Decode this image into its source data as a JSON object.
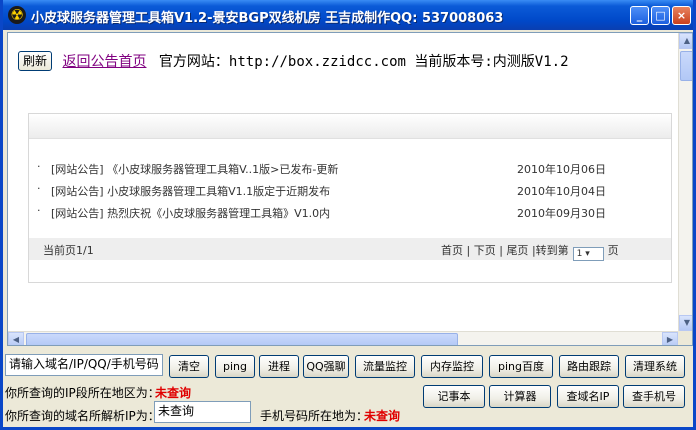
{
  "window": {
    "title": "小皮球服务器管理工具箱V1.2-景安BGP双线机房 王吉成制作QQ: 537008063",
    "minimize": "_",
    "maximize": "□",
    "close": "×"
  },
  "browser": {
    "refresh_label": "刷新",
    "home_link": "返回公告首页",
    "site_text": "官方网站：http://box.zzidcc.com 当前版本号:内测版V1.2",
    "news": [
      {
        "bullet": "·",
        "text": "[网站公告] 《小皮球服务器管理工具箱V..1版>已发布-更新",
        "date": "2010年10月06日"
      },
      {
        "bullet": "·",
        "text": "[网站公告] 小皮球服务器管理工具箱V1.1版定于近期发布",
        "date": "2010年10月04日"
      },
      {
        "bullet": "·",
        "text": "[网站公告] 热烈庆祝《小皮球服务器管理工具箱》V1.0内",
        "date": "2010年09月30日"
      }
    ],
    "pager": {
      "current": "当前页1/1",
      "first": "首页",
      "prev": "下页",
      "last": "尾页",
      "goto": "转到第",
      "page_value": "1",
      "page_suffix": "页",
      "sep": "|"
    }
  },
  "tools": {
    "query_input": "请输入域名/IP/QQ/手机号码",
    "buttons_row1": [
      "清空",
      "ping",
      "进程",
      "QQ强聊",
      "流量监控",
      "内存监控",
      "ping百度",
      "路由跟踪",
      "清理系统"
    ],
    "buttons_row2": [
      "记事本",
      "计算器",
      "查域名IP",
      "查手机号"
    ],
    "ip_region_label": "你所查询的IP段所在地区为：",
    "ip_region_value": "未查询",
    "domain_ip_label": "你所查询的域名所解析IP为：",
    "domain_ip_value": "未查询",
    "phone_label": "手机号码所在地为：",
    "phone_value": "未查询"
  },
  "colors": {
    "titlebar": "#0048c8",
    "link_visited": "#800080",
    "status_red": "#e00000"
  }
}
